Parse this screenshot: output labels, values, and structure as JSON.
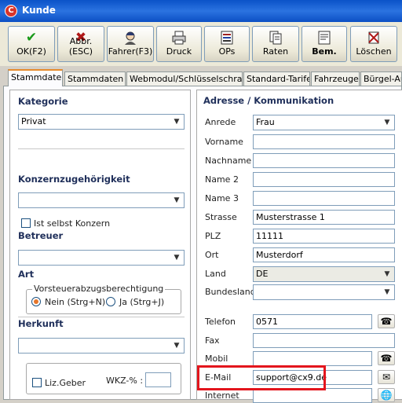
{
  "window": {
    "title": "Kunde",
    "app_icon": "app-logo-icon"
  },
  "toolbar": {
    "ok_label": "OK(F2)",
    "abbr_label": "Abbr.(ESC)",
    "fahrer_label": "Fahrer(F3)",
    "druck_label": "Druck",
    "ops_label": "OPs",
    "raten_label": "Raten",
    "bem_label": "Bem.",
    "loeschen_label": "Löschen"
  },
  "tabs": [
    "Stammdaten",
    "Stammdaten 2",
    "Webmodul/Schlüsselschrank",
    "Standard-Tarife",
    "Fahrzeuge",
    "Bürgel-Aus"
  ],
  "left": {
    "kategorie_title": "Kategorie",
    "kategorie_value": "Privat",
    "konzern_title": "Konzernzugehörigkeit",
    "konzern_value": "",
    "ist_selbst_konzern": "Ist selbst Konzern",
    "betreuer_title": "Betreuer",
    "betreuer_value": "",
    "art_title": "Art",
    "vorsteuer_label": "Vorsteuerabzugsberechtigung",
    "radio_nein": "Nein (Strg+N)",
    "radio_ja": "Ja (Strg+J)",
    "herkunft_title": "Herkunft",
    "herkunft_value": "",
    "liz_geber": "Liz.Geber",
    "wkz_label": "WKZ-% :",
    "wkz_value": ""
  },
  "right": {
    "title": "Adresse / Kommunikation",
    "anrede_label": "Anrede",
    "anrede_value": "Frau",
    "vorname_label": "Vorname",
    "vorname_value": "",
    "nachname_label": "Nachname",
    "nachname_value": "",
    "name2_label": "Name 2",
    "name2_value": "",
    "name3_label": "Name 3",
    "name3_value": "",
    "strasse_label": "Strasse",
    "strasse_value": "Musterstrasse 1",
    "plz_label": "PLZ",
    "plz_value": "11111",
    "ort_label": "Ort",
    "ort_value": "Musterdorf",
    "land_label": "Land",
    "land_value": "DE",
    "bundesland_label": "Bundesland",
    "bundesland_value": "",
    "telefon_label": "Telefon",
    "telefon_value": "0571",
    "fax_label": "Fax",
    "fax_value": "",
    "mobil_label": "Mobil",
    "mobil_value": "",
    "email_label": "E-Mail",
    "email_value": "support@cx9.de",
    "internet_label": "Internet",
    "internet_value": ""
  },
  "colors": {
    "highlight": "#e3151d",
    "title_bar": "#0a52c8",
    "section_title": "#1f2f5a",
    "active_tab_accent": "#e68b2c"
  }
}
